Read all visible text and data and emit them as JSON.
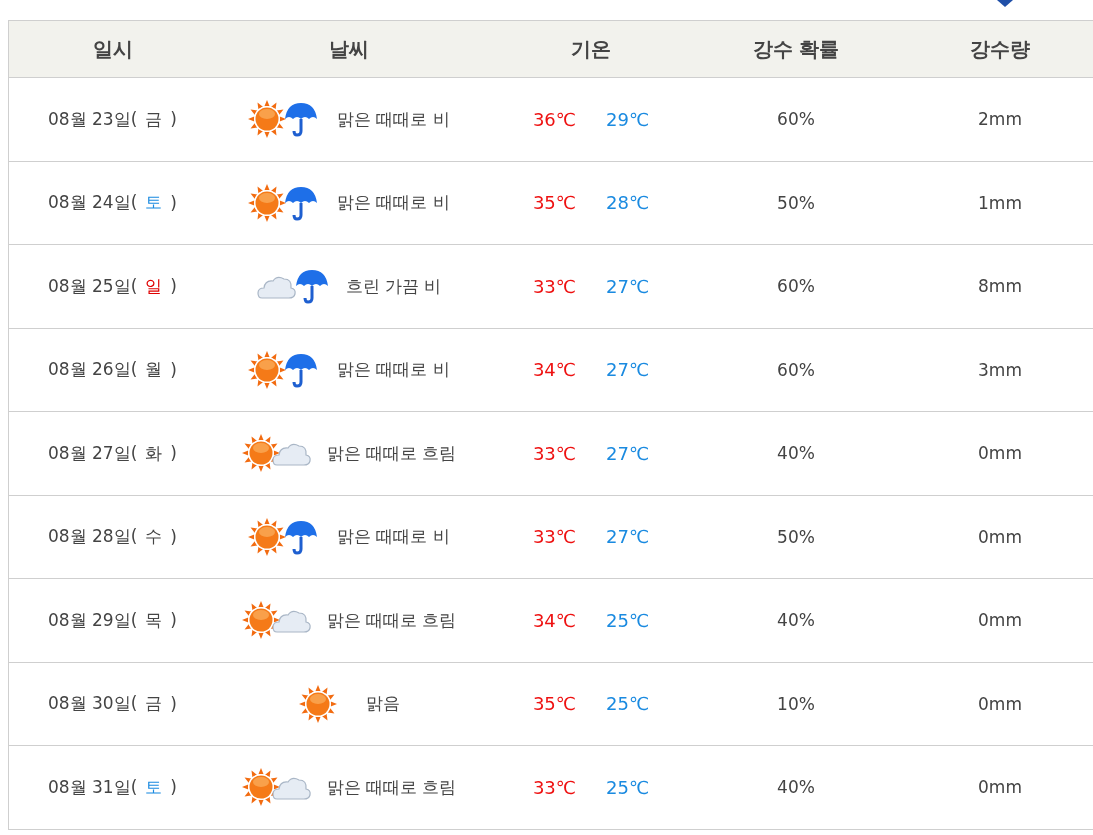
{
  "columns": [
    "일시",
    "날씨",
    "기온",
    "강수 확률",
    "강수량"
  ],
  "rows": [
    {
      "date": "08월 23일(",
      "weekday": "금",
      "color": "#444444",
      "close": ")",
      "kind": "sun_rain",
      "weather": "맑은 때때로 비",
      "high": "36℃",
      "low": "29℃",
      "probability": "60%",
      "amount": "2mm"
    },
    {
      "date": "08월 24일(",
      "weekday": "토",
      "color": "#1a8ae0",
      "close": ")",
      "kind": "sun_rain",
      "weather": "맑은 때때로 비",
      "high": "35℃",
      "low": "28℃",
      "probability": "50%",
      "amount": "1mm"
    },
    {
      "date": "08월 25일(",
      "weekday": "일",
      "color": "#e00000",
      "close": ")",
      "kind": "cloud_rain",
      "weather": "흐린 가끔 비",
      "high": "33℃",
      "low": "27℃",
      "probability": "60%",
      "amount": "8mm"
    },
    {
      "date": "08월 26일(",
      "weekday": "월",
      "color": "#444444",
      "close": ")",
      "kind": "sun_rain",
      "weather": "맑은 때때로 비",
      "high": "34℃",
      "low": "27℃",
      "probability": "60%",
      "amount": "3mm"
    },
    {
      "date": "08월 27일(",
      "weekday": "화",
      "color": "#444444",
      "close": ")",
      "kind": "sun_cloud",
      "weather": "맑은 때때로 흐림",
      "high": "33℃",
      "low": "27℃",
      "probability": "40%",
      "amount": "0mm"
    },
    {
      "date": "08월 28일(",
      "weekday": "수",
      "color": "#444444",
      "close": ")",
      "kind": "sun_rain",
      "weather": "맑은 때때로 비",
      "high": "33℃",
      "low": "27℃",
      "probability": "50%",
      "amount": "0mm"
    },
    {
      "date": "08월 29일(",
      "weekday": "목",
      "color": "#444444",
      "close": ")",
      "kind": "sun_cloud",
      "weather": "맑은 때때로 흐림",
      "high": "34℃",
      "low": "25℃",
      "probability": "40%",
      "amount": "0mm"
    },
    {
      "date": "08월 30일(",
      "weekday": "금",
      "color": "#444444",
      "close": ")",
      "kind": "sun",
      "weather": "맑음",
      "high": "35℃",
      "low": "25℃",
      "probability": "10%",
      "amount": "0mm"
    },
    {
      "date": "08월 31일(",
      "weekday": "토",
      "color": "#1a8ae0",
      "close": ")",
      "kind": "sun_cloud",
      "weather": "맑은 때때로 흐림",
      "high": "33℃",
      "low": "25℃",
      "probability": "40%",
      "amount": "0mm"
    }
  ]
}
